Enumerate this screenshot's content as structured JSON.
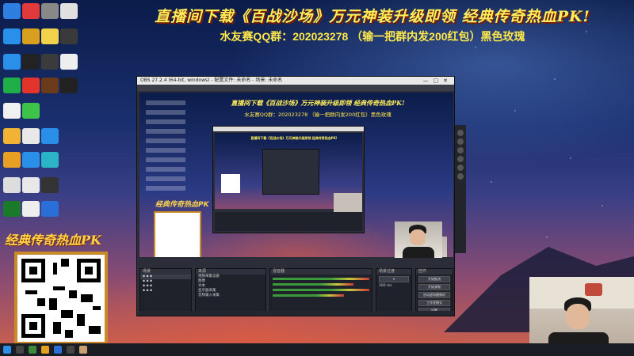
{
  "stream_banner": {
    "line1": "直播间下载《百战沙场》万元神装升级即领  经典传奇热血PK!",
    "line2": "水友赛QQ群：202023278  （输一把群内发200红包）黑色玫瑰"
  },
  "promo": {
    "title": "经典传奇热血PK"
  },
  "obs": {
    "window_title": "OBS 27.2.4 (64-bit, windows) - 配置文件: 未命名 - 场景: 未命名",
    "docks": {
      "scenes": "场景",
      "sources": "来源",
      "mixer": "混音器",
      "transitions": "场景过渡",
      "controls": "控件"
    },
    "source_rows": [
      "视频采集设备",
      "图像",
      "文本",
      "显示器采集",
      "音频输入采集"
    ],
    "control_buttons": [
      "开始推流",
      "开始录制",
      "启动虚拟摄像机",
      "工作室模式",
      "设置",
      "退出"
    ],
    "transition_duration": "300 ms"
  },
  "colors": {
    "banner_yellow": "#fff05a",
    "obs_bg": "#2b2e38"
  }
}
